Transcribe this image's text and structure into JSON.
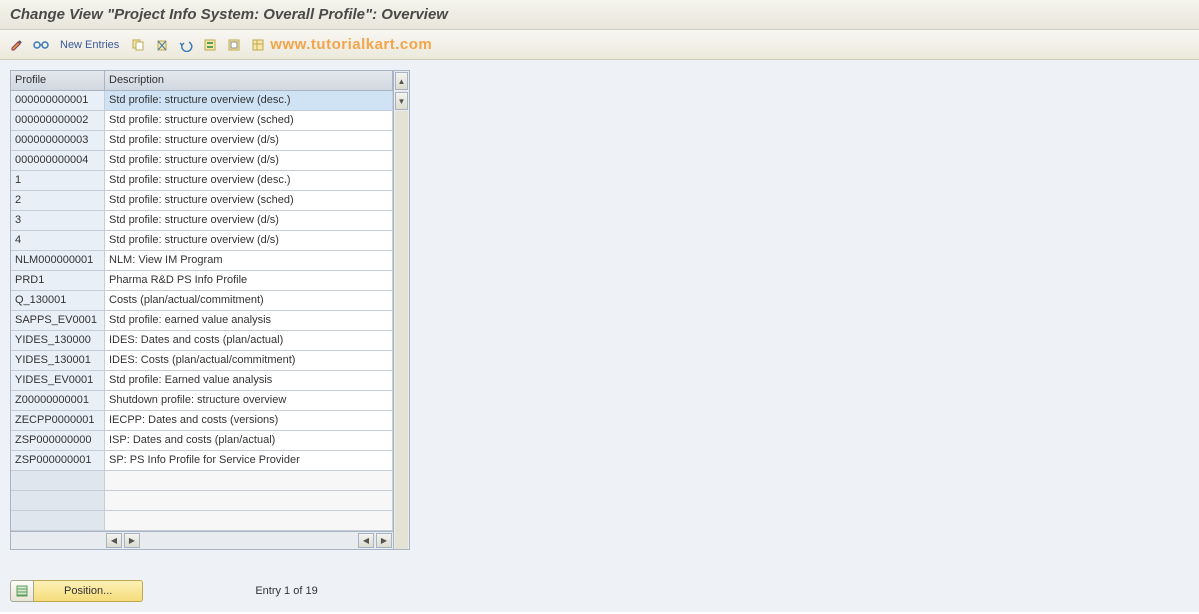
{
  "title": "Change View \"Project Info System: Overall Profile\": Overview",
  "toolbar": {
    "new_entries_label": "New Entries"
  },
  "watermark": "www.tutorialkart.com",
  "table": {
    "headers": {
      "profile": "Profile",
      "description": "Description"
    },
    "rows": [
      {
        "profile": "000000000001",
        "desc": "Std profile: structure overview (desc.)",
        "selected": true
      },
      {
        "profile": "000000000002",
        "desc": "Std profile: structure overview (sched)"
      },
      {
        "profile": "000000000003",
        "desc": "Std profile: structure overview (d/s)"
      },
      {
        "profile": "000000000004",
        "desc": "Std profile: structure overview (d/s)"
      },
      {
        "profile": "1",
        "desc": "Std profile: structure overview (desc.)"
      },
      {
        "profile": "2",
        "desc": "Std profile: structure overview (sched)"
      },
      {
        "profile": "3",
        "desc": "Std profile: structure overview (d/s)"
      },
      {
        "profile": "4",
        "desc": "Std profile: structure overview (d/s)"
      },
      {
        "profile": "NLM000000001",
        "desc": "NLM: View IM Program"
      },
      {
        "profile": "PRD1",
        "desc": "Pharma R&D PS Info Profile"
      },
      {
        "profile": "Q_130001",
        "desc": "Costs (plan/actual/commitment)"
      },
      {
        "profile": "SAPPS_EV0001",
        "desc": "Std profile: earned value analysis"
      },
      {
        "profile": "YIDES_130000",
        "desc": "IDES: Dates and costs (plan/actual)"
      },
      {
        "profile": "YIDES_130001",
        "desc": "IDES: Costs (plan/actual/commitment)"
      },
      {
        "profile": "YIDES_EV0001",
        "desc": "Std profile: Earned value analysis"
      },
      {
        "profile": "Z00000000001",
        "desc": "Shutdown profile: structure overview"
      },
      {
        "profile": "ZECPP0000001",
        "desc": "IECPP: Dates and costs (versions)"
      },
      {
        "profile": "ZSP000000000",
        "desc": "ISP: Dates and costs (plan/actual)"
      },
      {
        "profile": "ZSP000000001",
        "desc": "SP: PS Info Profile for Service Provider"
      }
    ]
  },
  "footer": {
    "position_label": "Position...",
    "entry_info": "Entry 1 of 19"
  }
}
